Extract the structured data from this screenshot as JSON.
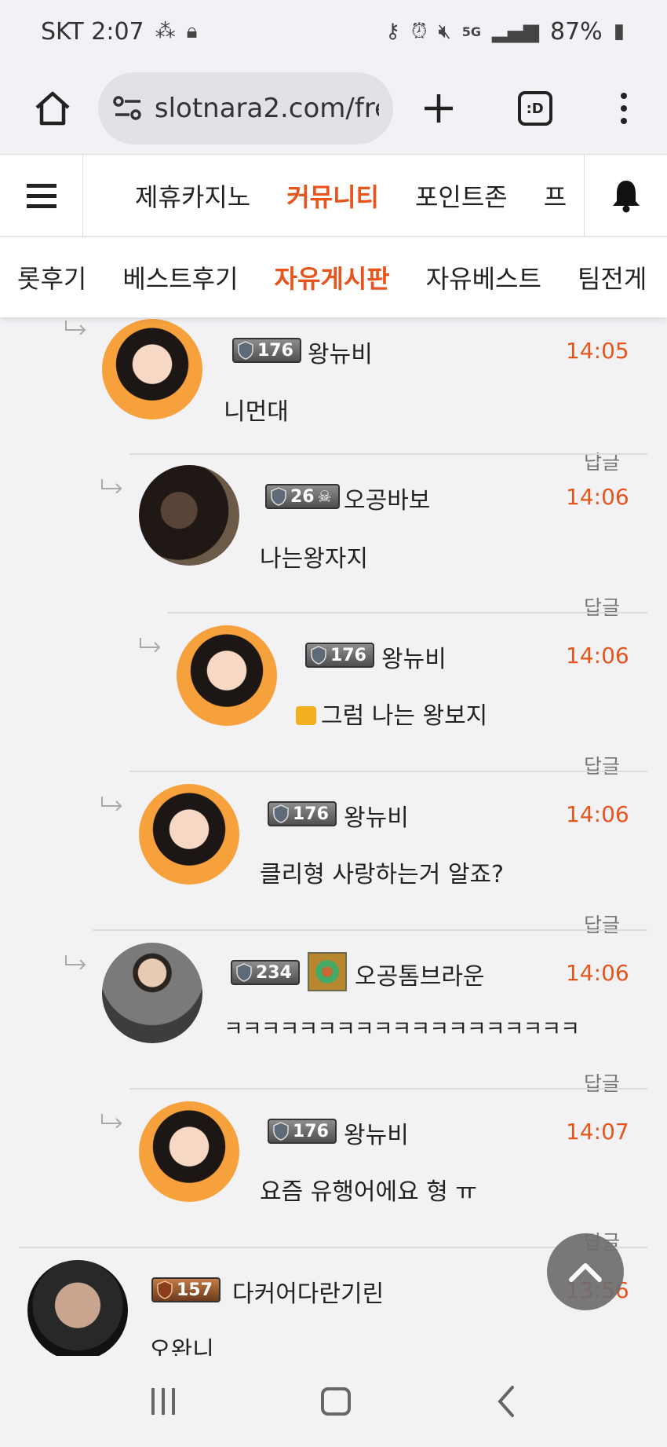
{
  "status_bar": {
    "carrier_time": "SKT 2:07",
    "signal_label": "5G",
    "battery": "87%"
  },
  "browser": {
    "url": "slotnara2.com/fre",
    "tabs_label": ":D"
  },
  "site_nav": {
    "items": [
      {
        "label": "제휴카지노"
      },
      {
        "label": "커뮤니티"
      },
      {
        "label": "포인트존"
      },
      {
        "label": "프"
      }
    ],
    "active_index": 1
  },
  "sub_tabs": {
    "items": [
      {
        "label": "롯후기"
      },
      {
        "label": "베스트후기"
      },
      {
        "label": "자유게시판"
      },
      {
        "label": "자유베스트"
      },
      {
        "label": "팀전게"
      }
    ],
    "active_index": 2
  },
  "comments": [
    {
      "level": "176",
      "author": "왕뉴비",
      "time": "14:05",
      "text": "니먼대",
      "reply": "답글",
      "avatar": "girl"
    },
    {
      "level": "26",
      "author": "오공바보",
      "time": "14:06",
      "text": "나는왕자지",
      "reply": "답글",
      "avatar": "man1"
    },
    {
      "level": "176",
      "author": "왕뉴비",
      "time": "14:06",
      "text": "그럼 나는 왕보지",
      "reply": "답글",
      "avatar": "girl",
      "lock_icon": "lock-emoji"
    },
    {
      "level": "176",
      "author": "왕뉴비",
      "time": "14:06",
      "text": "클리형 사랑하는거 알죠?",
      "reply": "답글",
      "avatar": "girl"
    },
    {
      "level": "234",
      "author": "오공톰브라운",
      "time": "14:06",
      "text": "ㅋㅋㅋㅋㅋㅋㅋㅋㅋㅋㅋㅋㅋㅋㅋㅋㅋㅋㅋ",
      "reply": "답글",
      "avatar": "man2"
    },
    {
      "level": "176",
      "author": "왕뉴비",
      "time": "14:07",
      "text": "요즘 유행어에요 형 ㅠ",
      "reply": "답글",
      "avatar": "girl"
    },
    {
      "level": "157",
      "author": "다커어다란기린",
      "time": "13:56",
      "text": "오완니",
      "avatar": "man3"
    }
  ],
  "colors": {
    "accent": "#e8541b",
    "background": "#f2f2f5"
  }
}
